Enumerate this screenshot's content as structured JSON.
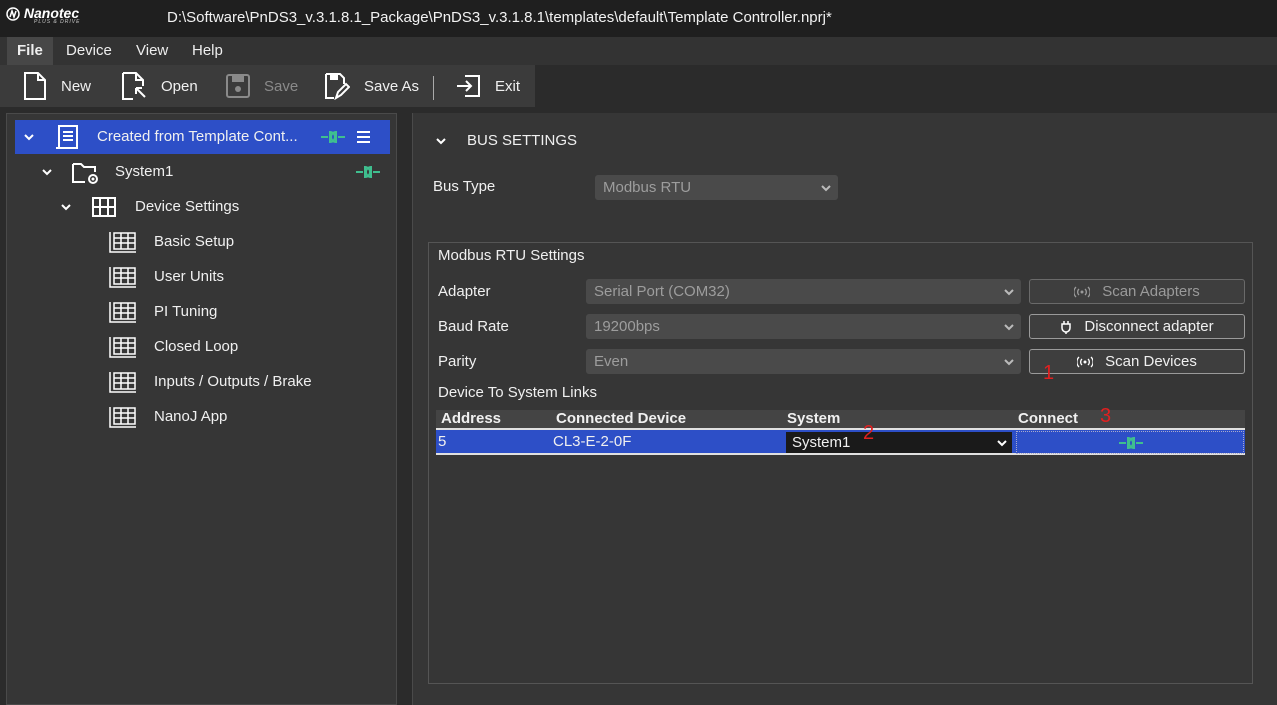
{
  "app": {
    "brand": "Nanotec",
    "brand_tagline": "PLUS & DRIVE",
    "window_title": "D:\\Software\\PnDS3_v.3.1.8.1_Package\\PnDS3_v.3.1.8.1\\templates\\default\\Template Controller.nprj*"
  },
  "menu": {
    "items": [
      "File",
      "Device",
      "View",
      "Help"
    ]
  },
  "toolbar": {
    "new_label": "New",
    "open_label": "Open",
    "save_label": "Save",
    "save_as_label": "Save As",
    "exit_label": "Exit"
  },
  "tree": {
    "project": "Created from Template Cont...",
    "system": "System1",
    "device_settings": "Device Settings",
    "children": [
      "Basic Setup",
      "User Units",
      "PI Tuning",
      "Closed Loop",
      "Inputs / Outputs / Brake",
      "NanoJ App"
    ]
  },
  "bus": {
    "section_title": "BUS SETTINGS",
    "bus_type_label": "Bus Type",
    "bus_type_value": "Modbus RTU"
  },
  "modbus": {
    "group_title": "Modbus RTU Settings",
    "adapter_label": "Adapter",
    "adapter_value": "Serial Port (COM32)",
    "baud_label": "Baud Rate",
    "baud_value": "19200bps",
    "parity_label": "Parity",
    "parity_value": "Even",
    "scan_adapters_label": "Scan Adapters",
    "disconnect_label": "Disconnect adapter",
    "scan_devices_label": "Scan Devices",
    "links_label": "Device To System Links"
  },
  "table": {
    "headers": [
      "Address",
      "Connected Device",
      "System",
      "Connect"
    ],
    "rows": [
      {
        "address": "5",
        "device": "CL3-E-2-0F",
        "system": "System1"
      }
    ]
  },
  "annotations": [
    "1",
    "2",
    "3"
  ],
  "colors": {
    "selection": "#2d4fc7",
    "connect_icon": "#3fbf8f",
    "annotation": "#e02020"
  }
}
